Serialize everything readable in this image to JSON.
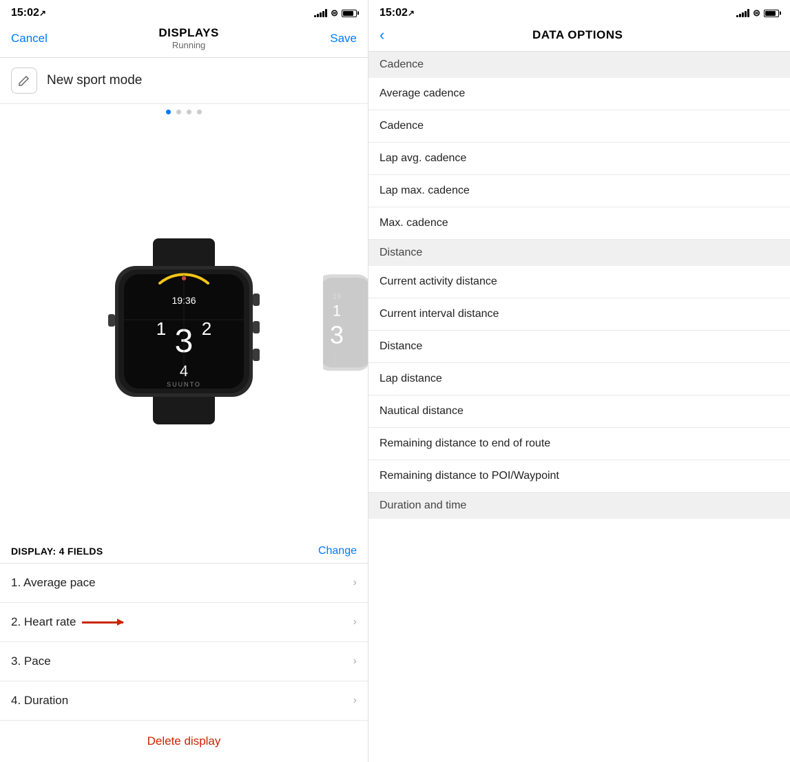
{
  "left": {
    "statusTime": "15:02",
    "navTitle": "DISPLAYS",
    "navSubtitle": "Running",
    "cancelLabel": "Cancel",
    "saveLabel": "Save",
    "sportModeLabel": "New sport mode",
    "displayTitle": "DISPLAY: 4 FIELDS",
    "changeLabel": "Change",
    "fields": [
      {
        "id": 1,
        "label": "1. Average pace",
        "highlighted": false
      },
      {
        "id": 2,
        "label": "2. Heart rate",
        "highlighted": true,
        "hasArrow": true
      },
      {
        "id": 3,
        "label": "3. Pace",
        "highlighted": false
      },
      {
        "id": 4,
        "label": "4. Duration",
        "highlighted": false
      }
    ],
    "deleteLabel": "Delete display"
  },
  "right": {
    "statusTime": "15:02",
    "navTitle": "DATA OPTIONS",
    "backLabel": "‹",
    "sections": [
      {
        "header": "Cadence",
        "items": [
          "Average cadence",
          "Cadence",
          "Lap avg. cadence",
          "Lap max. cadence",
          "Max. cadence"
        ]
      },
      {
        "header": "Distance",
        "items": [
          "Current activity distance",
          "Current interval distance",
          "Distance",
          "Lap distance",
          "Nautical distance",
          "Remaining distance to end of route",
          "Remaining distance to POI/Waypoint"
        ]
      },
      {
        "header": "Duration and time",
        "items": []
      }
    ]
  }
}
